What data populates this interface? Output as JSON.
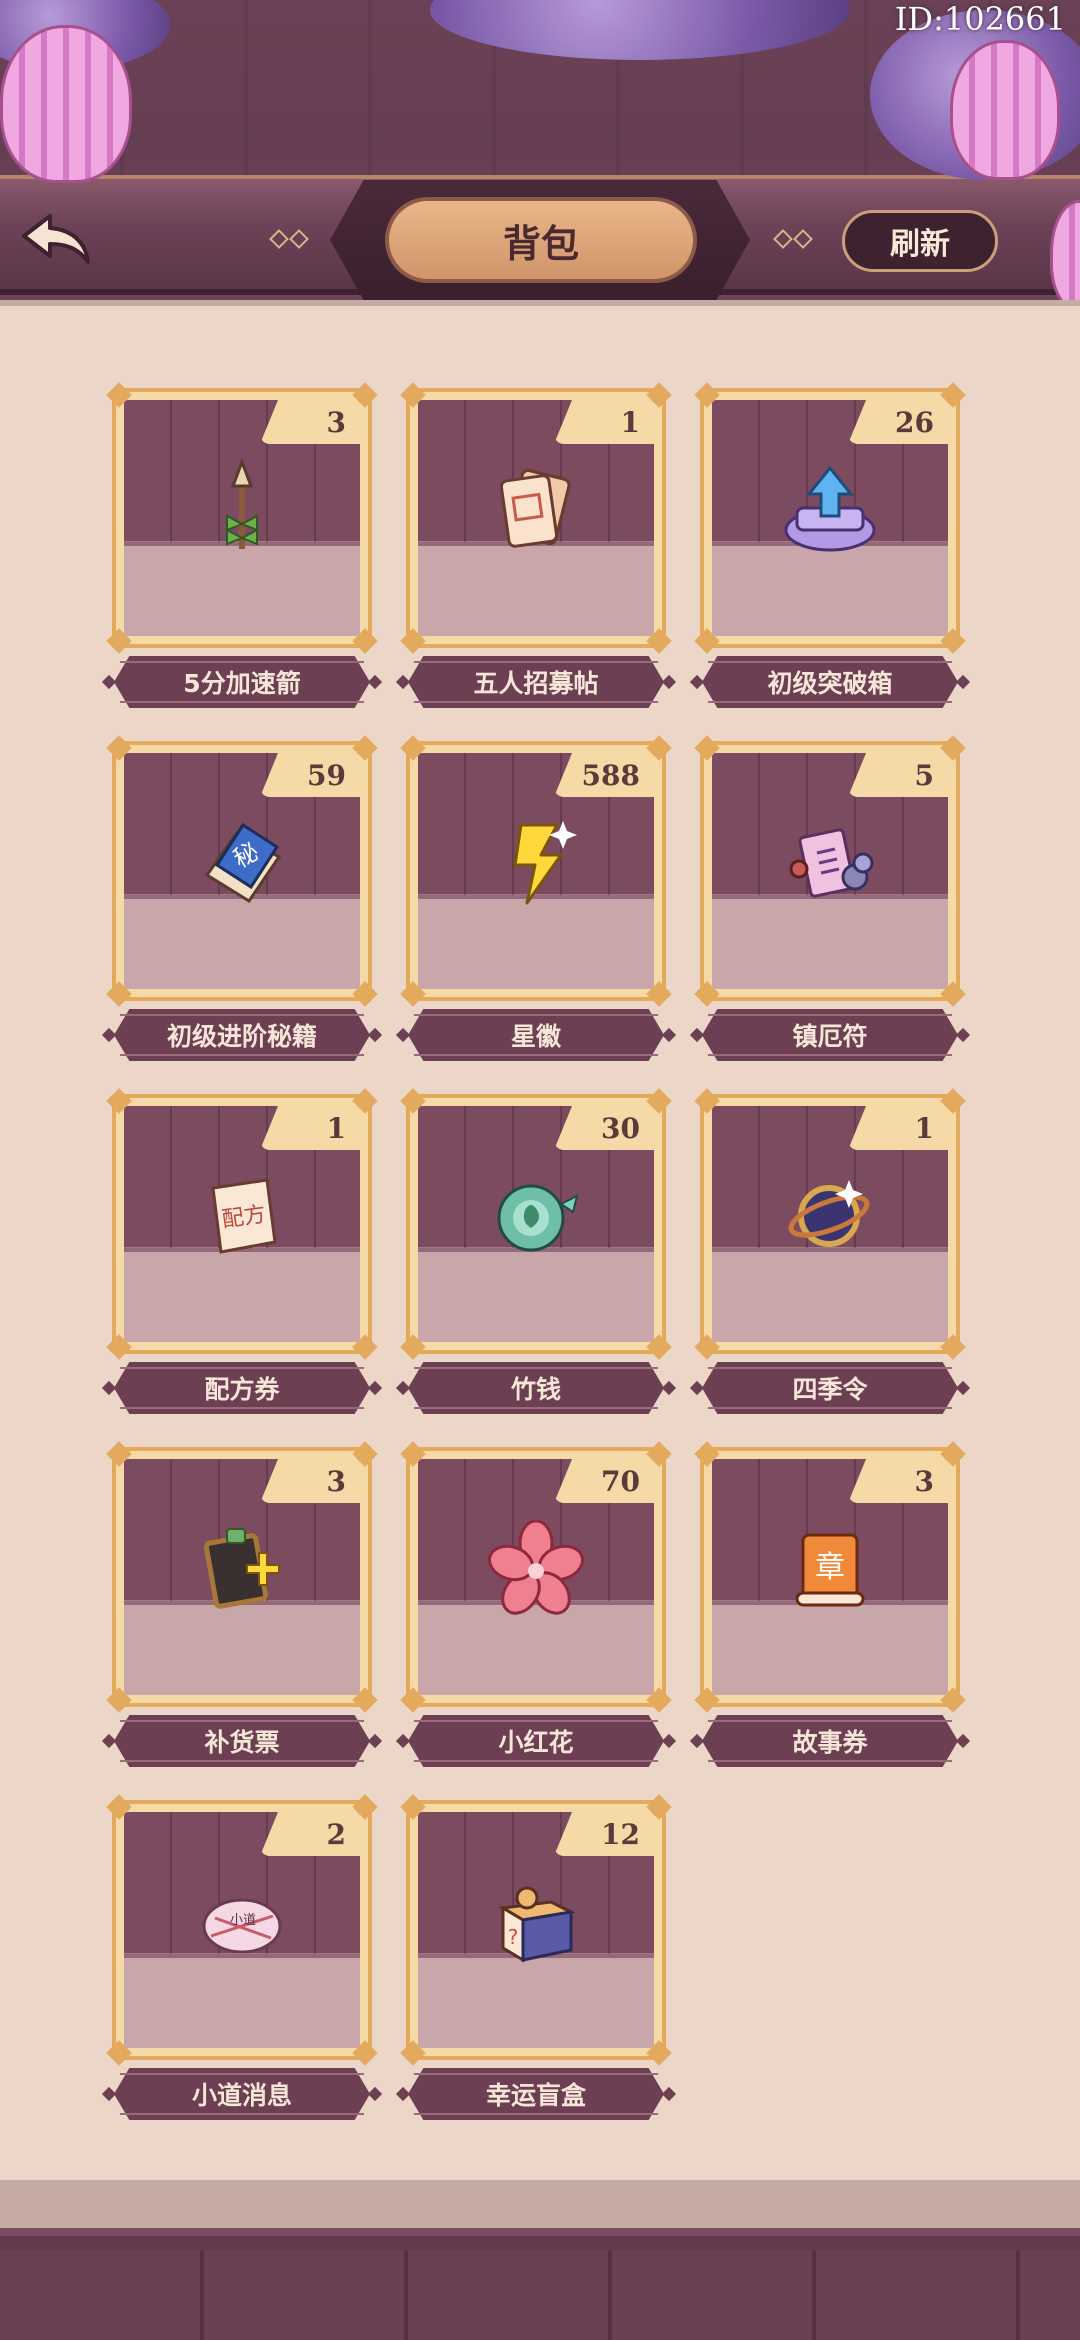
{
  "header": {
    "user_id": "ID:102661",
    "title": "背包",
    "refresh_label": "刷新",
    "back_icon": "back-arrow-icon"
  },
  "inventory": [
    {
      "name": "5分加速箭",
      "count": "3",
      "icon": "arrow-icon"
    },
    {
      "name": "五人招募帖",
      "count": "1",
      "icon": "recruit-card-icon"
    },
    {
      "name": "初级突破箱",
      "count": "26",
      "icon": "breakthrough-box-icon"
    },
    {
      "name": "初级进阶秘籍",
      "count": "59",
      "icon": "secret-book-icon"
    },
    {
      "name": "星徽",
      "count": "588",
      "icon": "star-badge-icon"
    },
    {
      "name": "镇厄符",
      "count": "5",
      "icon": "talisman-icon"
    },
    {
      "name": "配方券",
      "count": "1",
      "icon": "recipe-ticket-icon"
    },
    {
      "name": "竹钱",
      "count": "30",
      "icon": "bamboo-coin-icon"
    },
    {
      "name": "四季令",
      "count": "1",
      "icon": "season-token-icon"
    },
    {
      "name": "补货票",
      "count": "3",
      "icon": "restock-ticket-icon"
    },
    {
      "name": "小红花",
      "count": "70",
      "icon": "red-flower-icon"
    },
    {
      "name": "故事券",
      "count": "3",
      "icon": "story-scroll-icon"
    },
    {
      "name": "小道消息",
      "count": "2",
      "icon": "rumor-note-icon"
    },
    {
      "name": "幸运盲盒",
      "count": "12",
      "icon": "lucky-box-icon"
    }
  ],
  "colors": {
    "header_bg": "#6d4358",
    "content_bg": "#ecd6c8",
    "card_border": "#e3a95c",
    "card_bg": "#f5d9a6",
    "name_ribbon": "#6d3f52",
    "title_pill": "#d0956a"
  }
}
